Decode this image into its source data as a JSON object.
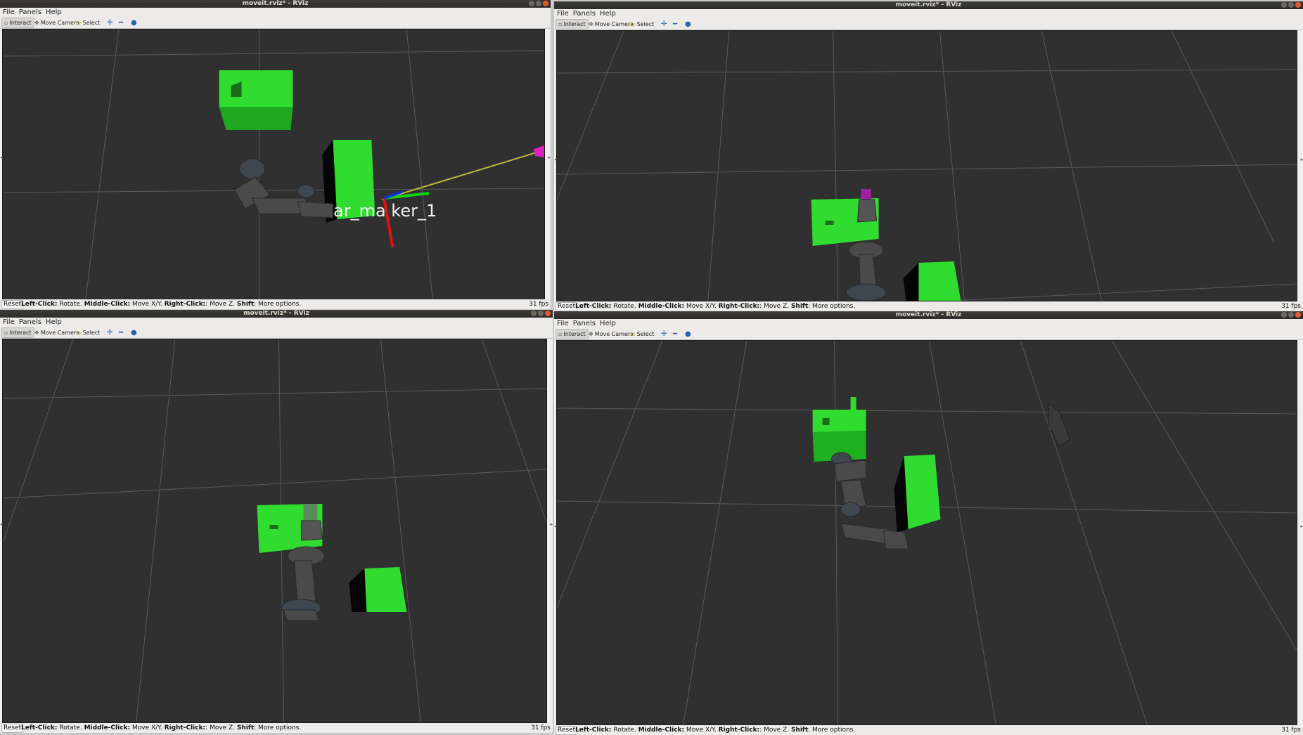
{
  "windows": [
    {
      "title": "moveit.rviz* - RViz",
      "menu": [
        "File",
        "Panels",
        "Help"
      ],
      "tools": {
        "interact": "Interact",
        "move_camera": "Move Camera",
        "select": "Select"
      },
      "reset": "Reset",
      "hint": {
        "left_key": "Left-Click:",
        "left_val": " Rotate. ",
        "middle_key": "Middle-Click:",
        "middle_val": " Move X/Y. ",
        "right_key": "Right-Click:",
        "right_val": ": Move Z. ",
        "shift_key": "Shift",
        "shift_val": ": More options."
      },
      "fps": "31 fps",
      "marker_label": "ar_ma ker_1"
    },
    {
      "title": "moveit.rviz* - RViz",
      "menu": [
        "File",
        "Panels",
        "Help"
      ],
      "tools": {
        "interact": "Interact",
        "move_camera": "Move Camera",
        "select": "Select"
      },
      "reset": "Reset",
      "hint": {
        "left_key": "Left-Click:",
        "left_val": " Rotate. ",
        "middle_key": "Middle-Click:",
        "middle_val": " Move X/Y. ",
        "right_key": "Right-Click:",
        "right_val": ": Move Z. ",
        "shift_key": "Shift",
        "shift_val": ": More options."
      },
      "fps": "31 fps"
    },
    {
      "title": "moveit.rviz* - RViz",
      "menu": [
        "File",
        "Panels",
        "Help"
      ],
      "tools": {
        "interact": "Interact",
        "move_camera": "Move Camera",
        "select": "Select"
      },
      "reset": "Reset",
      "hint": {
        "left_key": "Left-Click:",
        "left_val": " Rotate. ",
        "middle_key": "Middle-Click:",
        "middle_val": " Move X/Y. ",
        "right_key": "Right-Click:",
        "right_val": ": Move Z. ",
        "shift_key": "Shift",
        "shift_val": ": More options."
      },
      "fps": "31 fps"
    },
    {
      "title": "moveit.rviz* - RViz",
      "menu": [
        "File",
        "Panels",
        "Help"
      ],
      "tools": {
        "interact": "Interact",
        "move_camera": "Move Camera",
        "select": "Select"
      },
      "reset": "Reset",
      "hint": {
        "left_key": "Left-Click:",
        "left_val": " Rotate. ",
        "middle_key": "Middle-Click:",
        "middle_val": " Move X/Y. ",
        "right_key": "Right-Click:",
        "right_val": ": Move Z. ",
        "shift_key": "Shift",
        "shift_val": ": More options."
      },
      "fps": "31 fps"
    }
  ],
  "colors": {
    "box_green": "#2fdc2f",
    "grid": "#5a5a5a",
    "background": "#303030",
    "axis_red": "#e01010",
    "axis_green": "#10d010",
    "axis_blue": "#1030e0",
    "ray": "#b8b840",
    "arrow_magenta": "#e020c0"
  }
}
